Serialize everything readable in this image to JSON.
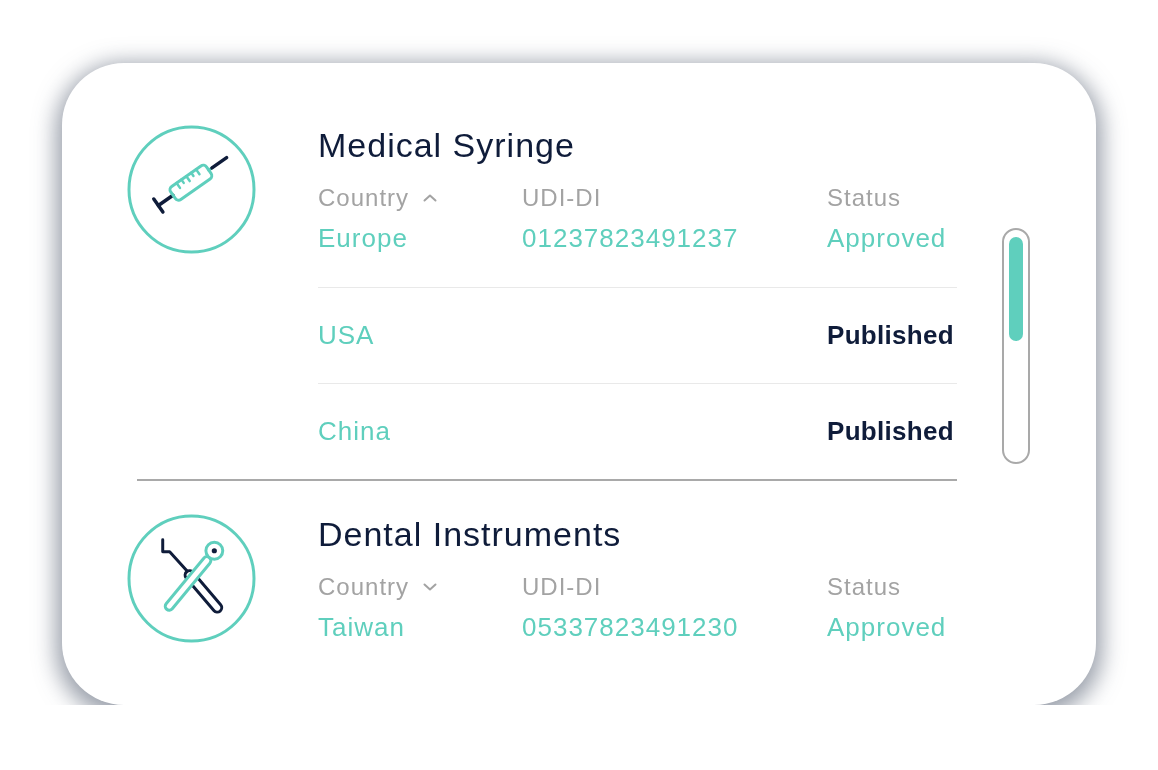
{
  "products": [
    {
      "name": "Medical Syringe",
      "country_header": {
        "label": "Country",
        "expanded": true
      },
      "udi_header": "UDI-DI",
      "status_header": "Status",
      "rows": [
        {
          "kind": "approved",
          "country": "Europe",
          "udi_di": "01237823491237",
          "status": "Approved"
        },
        {
          "kind": "published",
          "country": "USA",
          "status": "Published"
        },
        {
          "kind": "published",
          "country": "China",
          "status": "Published"
        }
      ]
    },
    {
      "name": "Dental Instruments",
      "country_header": {
        "label": "Country",
        "expanded": false
      },
      "udi_header": "UDI-DI",
      "status_header": "Status",
      "rows": [
        {
          "kind": "approved",
          "country": "Taiwan",
          "udi_di": "05337823491230",
          "status": "Approved"
        }
      ]
    }
  ]
}
